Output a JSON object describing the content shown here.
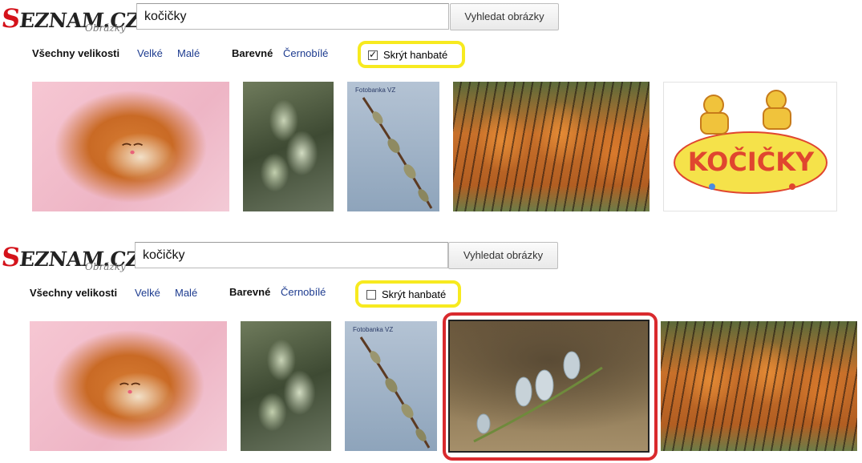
{
  "top": {
    "logo": {
      "brand_main": "SEZNAM.CZ",
      "brand_initial": "S",
      "brand_rest": "EZNAM.CZ",
      "brand_sub": "Obrázky"
    },
    "search": {
      "value": "kočičky",
      "button_label": "Vyhledat obrázky"
    },
    "filters": {
      "size_all": "Všechny velikosti",
      "size_large": "Velké",
      "size_small": "Malé",
      "color": "Barevné",
      "bw": "Černobílé",
      "safe_search_label": "Skrýt hanbaté",
      "safe_search_checked": true
    },
    "images": [
      {
        "kind": "kitten-photo-icon"
      },
      {
        "kind": "willow-catkins-photo-icon"
      },
      {
        "kind": "branch-photo-icon",
        "watermark": "Fotobanka VZ"
      },
      {
        "kind": "tiger-cubs-photo-icon"
      },
      {
        "kind": "cartoon-cats-illustration-icon",
        "text": "KOČIČKY"
      }
    ]
  },
  "bottom": {
    "logo": {
      "brand_main": "SEZNAM.CZ",
      "brand_initial": "S",
      "brand_rest": "EZNAM.CZ",
      "brand_sub": "Obrázky"
    },
    "search": {
      "value": "kočičky",
      "button_label": "Vyhledat obrázky"
    },
    "filters": {
      "size_all": "Všechny velikosti",
      "size_large": "Velké",
      "size_small": "Malé",
      "color": "Barevné",
      "bw": "Černobílé",
      "safe_search_label": "Skrýt hanbaté",
      "safe_search_checked": false
    },
    "images": [
      {
        "kind": "kitten-photo-icon"
      },
      {
        "kind": "willow-catkins-photo-icon"
      },
      {
        "kind": "branch-photo-icon",
        "watermark": "Fotobanka VZ"
      },
      {
        "kind": "catkins-closeup-photo-icon",
        "highlighted": true
      },
      {
        "kind": "tiger-cubs-photo-icon"
      }
    ]
  },
  "colors": {
    "highlight_yellow": "#f7ea1f",
    "highlight_red": "#d92a2e",
    "link_blue": "#1d3b8f",
    "logo_red": "#d4121a"
  }
}
